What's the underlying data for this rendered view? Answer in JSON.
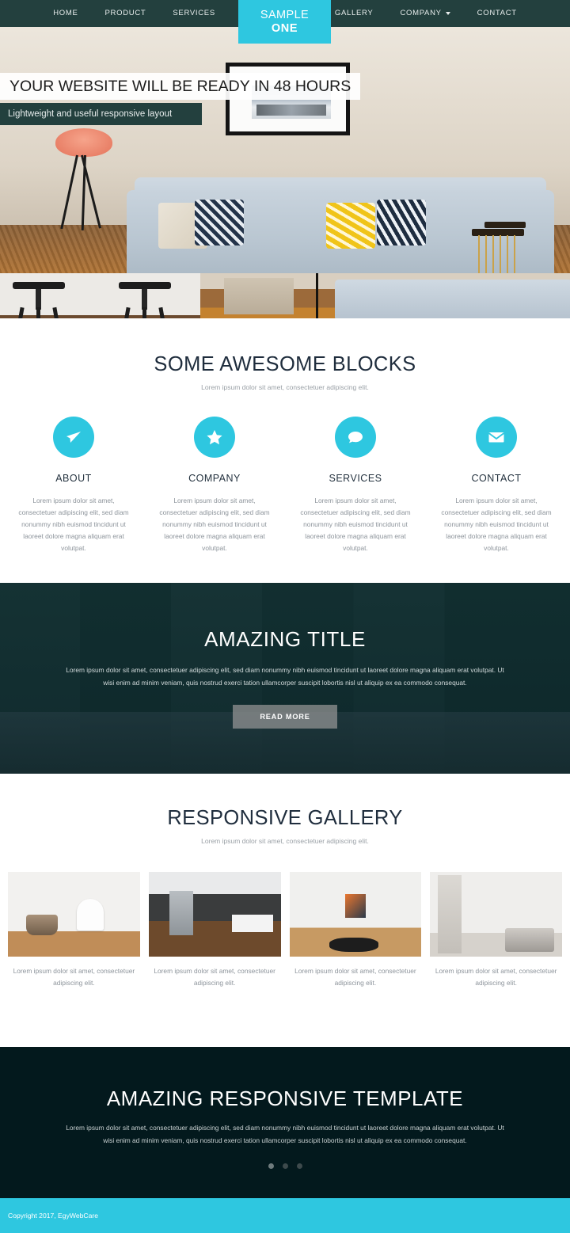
{
  "nav": {
    "items": [
      {
        "label": "HOME",
        "icon": null
      },
      {
        "label": "PRODUCT",
        "icon": null
      },
      {
        "label": "SERVICES",
        "icon": null
      }
    ],
    "items_right": [
      {
        "label": "GALLERY",
        "icon": null
      },
      {
        "label": "COMPANY",
        "icon": "chevron-down-icon"
      },
      {
        "label": "CONTACT",
        "icon": null
      }
    ],
    "logo": {
      "line1": "SAMPLE",
      "line2": "ONE"
    },
    "bg_color": "#23403e",
    "logo_color": "#2ec7e0"
  },
  "hero": {
    "title": "YOUR WEBSITE WILL BE READY IN 48 HOURS",
    "subtitle": "Lightweight and useful responsive layout"
  },
  "blocks": {
    "title": "SOME AWESOME BLOCKS",
    "subtitle": "Lorem ipsum dolor sit amet, consectetuer adipiscing elit.",
    "cards": [
      {
        "icon": "paper-plane-icon",
        "title": "ABOUT",
        "text": "Lorem ipsum dolor sit amet, consectetuer adipiscing elit, sed diam nonummy nibh euismod tincidunt ut laoreet dolore magna aliquam erat volutpat."
      },
      {
        "icon": "star-icon",
        "title": "COMPANY",
        "text": "Lorem ipsum dolor sit amet, consectetuer adipiscing elit, sed diam nonummy nibh euismod tincidunt ut laoreet dolore magna aliquam erat volutpat."
      },
      {
        "icon": "chat-bubble-icon",
        "title": "SERVICES",
        "text": "Lorem ipsum dolor sit amet, consectetuer adipiscing elit, sed diam nonummy nibh euismod tincidunt ut laoreet dolore magna aliquam erat volutpat."
      },
      {
        "icon": "envelope-icon",
        "title": "CONTACT",
        "text": "Lorem ipsum dolor sit amet, consectetuer adipiscing elit, sed diam nonummy nibh euismod tincidunt ut laoreet dolore magna aliquam erat volutpat."
      }
    ],
    "accent_color": "#2ec7e0"
  },
  "parallax": {
    "title": "AMAZING TITLE",
    "text": "Lorem ipsum dolor sit amet, consectetuer adipiscing elit, sed diam nonummy nibh euismod tincidunt ut laoreet dolore magna aliquam erat volutpat. Ut wisi enim ad minim veniam, quis nostrud exerci tation ullamcorper suscipit lobortis nisl ut aliquip ex ea commodo consequat.",
    "button": "READ MORE"
  },
  "gallery": {
    "title": "RESPONSIVE GALLERY",
    "subtitle": "Lorem ipsum dolor sit amet, consectetuer adipiscing elit.",
    "items": [
      {
        "caption": "Lorem ipsum dolor sit amet, consectetuer adipiscing elit."
      },
      {
        "caption": "Lorem ipsum dolor sit amet, consectetuer adipiscing elit."
      },
      {
        "caption": "Lorem ipsum dolor sit amet, consectetuer adipiscing elit."
      },
      {
        "caption": "Lorem ipsum dolor sit amet, consectetuer adipiscing elit."
      }
    ]
  },
  "cta": {
    "title": "AMAZING RESPONSIVE TEMPLATE",
    "text": "Lorem ipsum dolor sit amet, consectetuer adipiscing elit, sed diam nonummy nibh euismod tincidunt ut laoreet dolore magna aliquam erat volutpat. Ut wisi enim ad minim veniam, quis nostrud exerci tation ullamcorper suscipit lobortis nisl ut aliquip ex ea commodo consequat.",
    "dots": 3,
    "active_dot": 0,
    "bg_color": "#03191d"
  },
  "footer": {
    "copyright": "Copyright 2017, EgyWebCare",
    "bg_color": "#2ec7e0"
  }
}
